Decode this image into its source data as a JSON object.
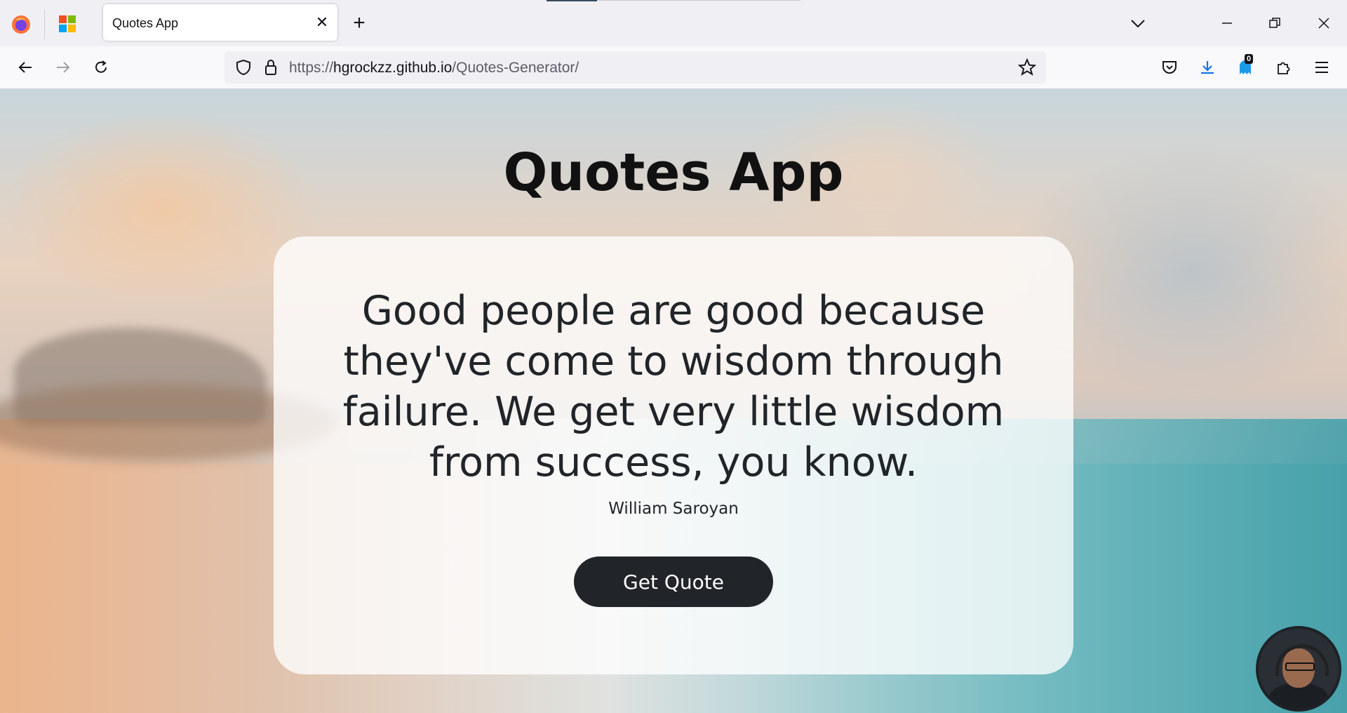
{
  "browser": {
    "tab_title": "Quotes App",
    "tab_close": "✕",
    "new_tab": "+",
    "url_prefix": "https://",
    "url_host": "hgrockzz.github.io",
    "url_path": "/Quotes-Generator/",
    "extension_badge": "0",
    "window_buttons": {
      "minimize": "—",
      "restore": "❐",
      "close": "✕"
    }
  },
  "page": {
    "title": "Quotes App",
    "quote": "Good people are good because they've come to wisdom through failure. We get very little wisdom from success, you know.",
    "author": "William Saroyan",
    "button_label": "Get Quote"
  },
  "colors": {
    "button_bg": "#212529",
    "card_bg": "rgba(255,255,255,0.78)",
    "text": "#212529"
  }
}
